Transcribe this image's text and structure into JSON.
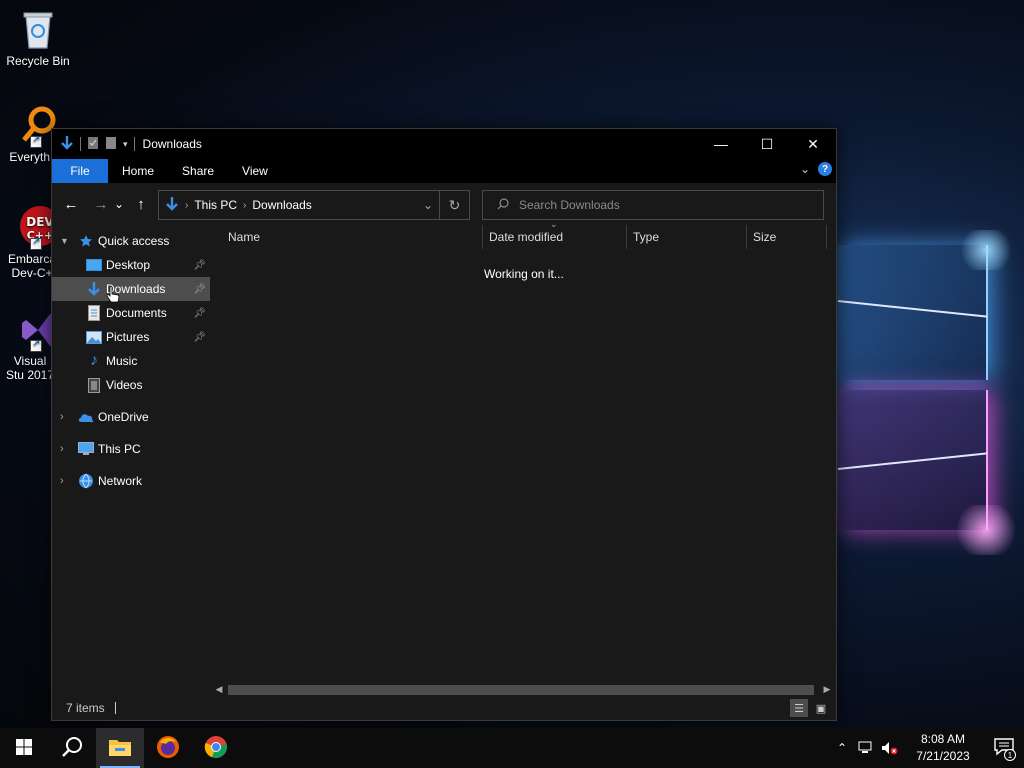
{
  "desktop": {
    "icons": [
      {
        "label": "Recycle Bin",
        "icon": "recycle-bin-icon"
      },
      {
        "label": "Everyth",
        "icon": "everything-search-icon"
      },
      {
        "label": "Embarca Dev-C+",
        "icon": "dev-cpp-icon"
      },
      {
        "label": "Visual Stu 2017",
        "icon": "visual-studio-icon"
      }
    ]
  },
  "window": {
    "title": "Downloads",
    "controls": {
      "minimize": "—",
      "maximize": "☐",
      "close": "✕"
    },
    "ribbon_tabs": [
      "File",
      "Home",
      "Share",
      "View"
    ],
    "help_label": "?"
  },
  "navigation": {
    "back": "←",
    "forward": "→",
    "recent": "⌄",
    "up": "↑",
    "breadcrumb": [
      "This PC",
      "Downloads"
    ],
    "search_placeholder": "Search Downloads"
  },
  "tree": {
    "quick_access": "Quick access",
    "items": [
      {
        "label": "Desktop",
        "icon": "desktop-folder-icon",
        "pinned": true,
        "selected": false
      },
      {
        "label": "Downloads",
        "icon": "downloads-folder-icon",
        "pinned": true,
        "selected": true
      },
      {
        "label": "Documents",
        "icon": "documents-folder-icon",
        "pinned": true,
        "selected": false
      },
      {
        "label": "Pictures",
        "icon": "pictures-folder-icon",
        "pinned": true,
        "selected": false
      },
      {
        "label": "Music",
        "icon": "music-folder-icon",
        "pinned": false,
        "selected": false
      },
      {
        "label": "Videos",
        "icon": "videos-folder-icon",
        "pinned": false,
        "selected": false
      }
    ],
    "roots": [
      {
        "label": "OneDrive",
        "icon": "onedrive-icon"
      },
      {
        "label": "This PC",
        "icon": "this-pc-icon"
      },
      {
        "label": "Network",
        "icon": "network-icon"
      }
    ]
  },
  "file_list": {
    "columns": [
      "Name",
      "Date modified",
      "Type",
      "Size"
    ],
    "status_message": "Working on it..."
  },
  "status_bar": {
    "item_count": "7 items"
  },
  "taskbar": {
    "apps": [
      "start-icon",
      "search-icon",
      "file-explorer-icon",
      "firefox-icon",
      "chrome-icon"
    ],
    "active_app": "file-explorer-icon",
    "time": "8:08 AM",
    "date": "7/21/2023",
    "notification_count": "1"
  },
  "colors": {
    "accent": "#1a6fd8",
    "window_bg": "#191919",
    "selected_bg": "#4d4d4d",
    "titlebar_bg": "#000000"
  }
}
